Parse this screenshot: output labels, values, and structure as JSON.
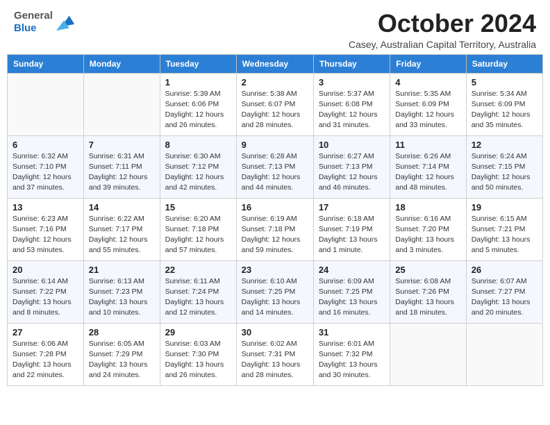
{
  "header": {
    "logo_line1": "General",
    "logo_line2": "Blue",
    "month_title": "October 2024",
    "subtitle": "Casey, Australian Capital Territory, Australia"
  },
  "days_of_week": [
    "Sunday",
    "Monday",
    "Tuesday",
    "Wednesday",
    "Thursday",
    "Friday",
    "Saturday"
  ],
  "weeks": [
    [
      {
        "day": "",
        "info": ""
      },
      {
        "day": "",
        "info": ""
      },
      {
        "day": "1",
        "info": "Sunrise: 5:39 AM\nSunset: 6:06 PM\nDaylight: 12 hours\nand 26 minutes."
      },
      {
        "day": "2",
        "info": "Sunrise: 5:38 AM\nSunset: 6:07 PM\nDaylight: 12 hours\nand 28 minutes."
      },
      {
        "day": "3",
        "info": "Sunrise: 5:37 AM\nSunset: 6:08 PM\nDaylight: 12 hours\nand 31 minutes."
      },
      {
        "day": "4",
        "info": "Sunrise: 5:35 AM\nSunset: 6:09 PM\nDaylight: 12 hours\nand 33 minutes."
      },
      {
        "day": "5",
        "info": "Sunrise: 5:34 AM\nSunset: 6:09 PM\nDaylight: 12 hours\nand 35 minutes."
      }
    ],
    [
      {
        "day": "6",
        "info": "Sunrise: 6:32 AM\nSunset: 7:10 PM\nDaylight: 12 hours\nand 37 minutes."
      },
      {
        "day": "7",
        "info": "Sunrise: 6:31 AM\nSunset: 7:11 PM\nDaylight: 12 hours\nand 39 minutes."
      },
      {
        "day": "8",
        "info": "Sunrise: 6:30 AM\nSunset: 7:12 PM\nDaylight: 12 hours\nand 42 minutes."
      },
      {
        "day": "9",
        "info": "Sunrise: 6:28 AM\nSunset: 7:13 PM\nDaylight: 12 hours\nand 44 minutes."
      },
      {
        "day": "10",
        "info": "Sunrise: 6:27 AM\nSunset: 7:13 PM\nDaylight: 12 hours\nand 46 minutes."
      },
      {
        "day": "11",
        "info": "Sunrise: 6:26 AM\nSunset: 7:14 PM\nDaylight: 12 hours\nand 48 minutes."
      },
      {
        "day": "12",
        "info": "Sunrise: 6:24 AM\nSunset: 7:15 PM\nDaylight: 12 hours\nand 50 minutes."
      }
    ],
    [
      {
        "day": "13",
        "info": "Sunrise: 6:23 AM\nSunset: 7:16 PM\nDaylight: 12 hours\nand 53 minutes."
      },
      {
        "day": "14",
        "info": "Sunrise: 6:22 AM\nSunset: 7:17 PM\nDaylight: 12 hours\nand 55 minutes."
      },
      {
        "day": "15",
        "info": "Sunrise: 6:20 AM\nSunset: 7:18 PM\nDaylight: 12 hours\nand 57 minutes."
      },
      {
        "day": "16",
        "info": "Sunrise: 6:19 AM\nSunset: 7:18 PM\nDaylight: 12 hours\nand 59 minutes."
      },
      {
        "day": "17",
        "info": "Sunrise: 6:18 AM\nSunset: 7:19 PM\nDaylight: 13 hours\nand 1 minute."
      },
      {
        "day": "18",
        "info": "Sunrise: 6:16 AM\nSunset: 7:20 PM\nDaylight: 13 hours\nand 3 minutes."
      },
      {
        "day": "19",
        "info": "Sunrise: 6:15 AM\nSunset: 7:21 PM\nDaylight: 13 hours\nand 5 minutes."
      }
    ],
    [
      {
        "day": "20",
        "info": "Sunrise: 6:14 AM\nSunset: 7:22 PM\nDaylight: 13 hours\nand 8 minutes."
      },
      {
        "day": "21",
        "info": "Sunrise: 6:13 AM\nSunset: 7:23 PM\nDaylight: 13 hours\nand 10 minutes."
      },
      {
        "day": "22",
        "info": "Sunrise: 6:11 AM\nSunset: 7:24 PM\nDaylight: 13 hours\nand 12 minutes."
      },
      {
        "day": "23",
        "info": "Sunrise: 6:10 AM\nSunset: 7:25 PM\nDaylight: 13 hours\nand 14 minutes."
      },
      {
        "day": "24",
        "info": "Sunrise: 6:09 AM\nSunset: 7:25 PM\nDaylight: 13 hours\nand 16 minutes."
      },
      {
        "day": "25",
        "info": "Sunrise: 6:08 AM\nSunset: 7:26 PM\nDaylight: 13 hours\nand 18 minutes."
      },
      {
        "day": "26",
        "info": "Sunrise: 6:07 AM\nSunset: 7:27 PM\nDaylight: 13 hours\nand 20 minutes."
      }
    ],
    [
      {
        "day": "27",
        "info": "Sunrise: 6:06 AM\nSunset: 7:28 PM\nDaylight: 13 hours\nand 22 minutes."
      },
      {
        "day": "28",
        "info": "Sunrise: 6:05 AM\nSunset: 7:29 PM\nDaylight: 13 hours\nand 24 minutes."
      },
      {
        "day": "29",
        "info": "Sunrise: 6:03 AM\nSunset: 7:30 PM\nDaylight: 13 hours\nand 26 minutes."
      },
      {
        "day": "30",
        "info": "Sunrise: 6:02 AM\nSunset: 7:31 PM\nDaylight: 13 hours\nand 28 minutes."
      },
      {
        "day": "31",
        "info": "Sunrise: 6:01 AM\nSunset: 7:32 PM\nDaylight: 13 hours\nand 30 minutes."
      },
      {
        "day": "",
        "info": ""
      },
      {
        "day": "",
        "info": ""
      }
    ]
  ]
}
